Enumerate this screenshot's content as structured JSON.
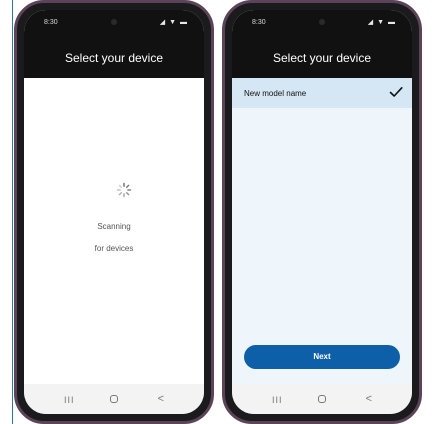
{
  "left_phone": {
    "status_time": "8:30",
    "status_icons": "◢ ▼ ▬",
    "title": "Select your device",
    "scanning_line1": "Scanning",
    "scanning_line2": "for devices"
  },
  "right_phone": {
    "status_time": "8:30",
    "status_icons": "◢ ▼ ▬",
    "title": "Select your device",
    "device_name": "New model name",
    "next_label": "Next"
  },
  "nav": {
    "recents_glyph": "III",
    "back_glyph": "<"
  },
  "colors": {
    "accent": "#0d5fa8",
    "selected_row": "#d5e7f5",
    "header_bg": "#111111"
  },
  "icons": [
    "spinner-icon",
    "checkmark-icon",
    "home-icon",
    "back-icon",
    "recents-icon"
  ]
}
